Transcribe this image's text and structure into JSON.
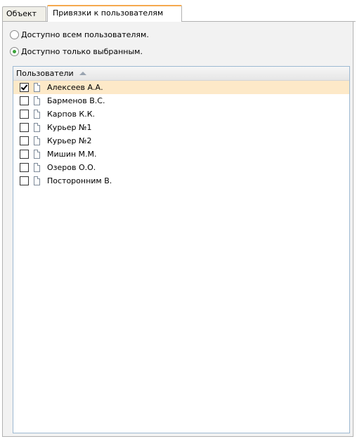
{
  "tabs": [
    {
      "label": "Объект",
      "active": false
    },
    {
      "label": "Привязки к пользователям",
      "active": true
    }
  ],
  "access": {
    "options": [
      {
        "label": "Доступно всем пользователям.",
        "checked": false
      },
      {
        "label": "Доступно только выбранным.",
        "checked": true
      }
    ]
  },
  "users_list": {
    "header": "Пользователи",
    "sort": "ascending",
    "items": [
      {
        "name": "Алексеев А.А.",
        "checked": true,
        "selected": true
      },
      {
        "name": "Барменов В.С.",
        "checked": false,
        "selected": false
      },
      {
        "name": "Карпов К.К.",
        "checked": false,
        "selected": false
      },
      {
        "name": "Курьер №1",
        "checked": false,
        "selected": false
      },
      {
        "name": "Курьер №2",
        "checked": false,
        "selected": false
      },
      {
        "name": "Мишин М.М.",
        "checked": false,
        "selected": false
      },
      {
        "name": "Озеров О.О.",
        "checked": false,
        "selected": false
      },
      {
        "name": "Посторонним В.",
        "checked": false,
        "selected": false
      }
    ]
  },
  "colors": {
    "active_tab_accent": "#f5a94e",
    "selected_row": "#fde9c8",
    "list_border": "#9db9d2",
    "radio_dot": "#3aa33a"
  }
}
